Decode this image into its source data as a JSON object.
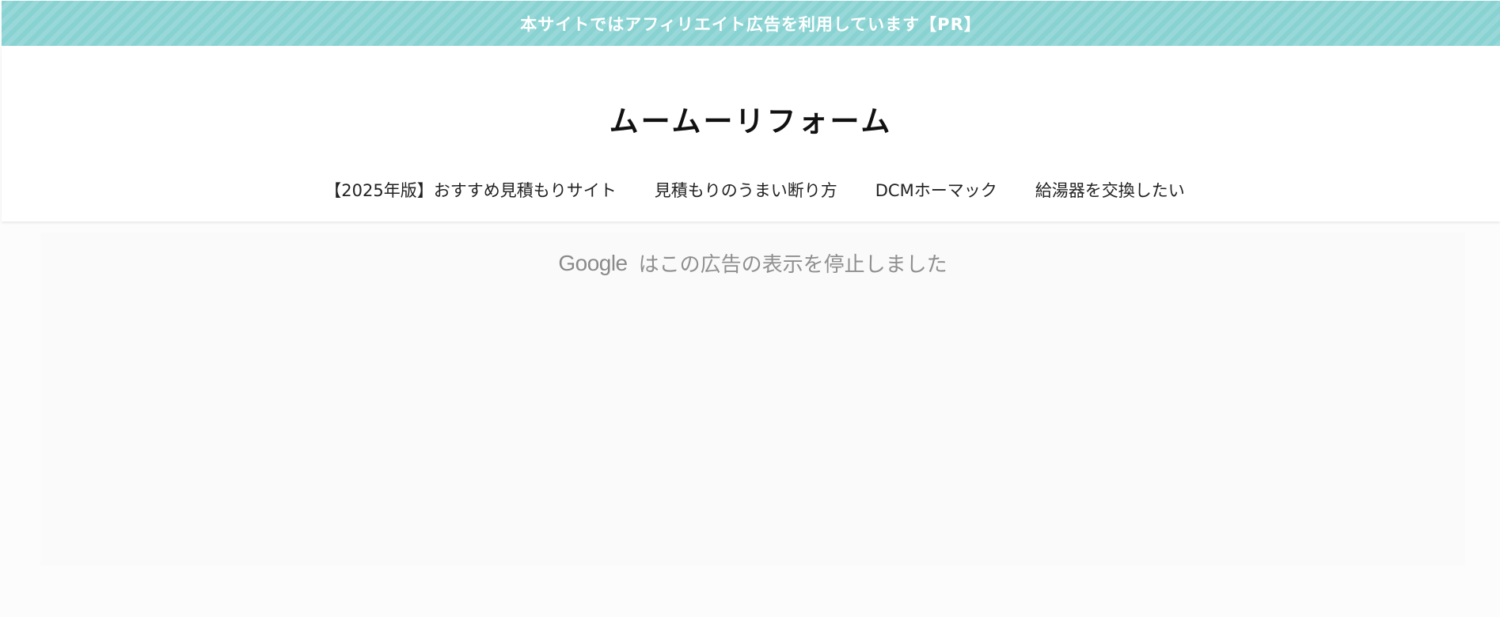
{
  "pr_bar": {
    "text": "本サイトではアフィリエイト広告を利用しています【PR】",
    "color": "#89d2d2"
  },
  "header": {
    "site_title": "ムームーリフォーム",
    "nav": [
      {
        "label": "【2025年版】おすすめ見積もりサイト"
      },
      {
        "label": "見積もりのうまい断り方"
      },
      {
        "label": "DCMホーマック"
      },
      {
        "label": "給湯器を交換したい"
      }
    ]
  },
  "ad": {
    "logo": "Google",
    "message": "はこの広告の表示を停止しました"
  }
}
